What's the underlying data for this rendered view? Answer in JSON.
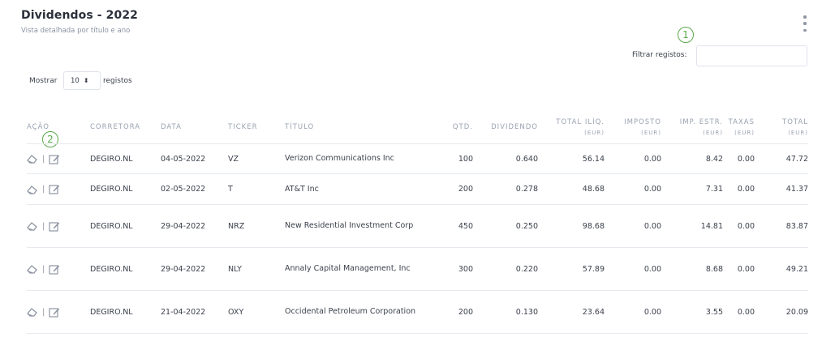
{
  "card": {
    "title": "Dividendos - 2022",
    "subtitle": "Vista detalhada por título e ano"
  },
  "markers": [
    "1",
    "2"
  ],
  "filter": {
    "label": "Filtrar registos:",
    "value": ""
  },
  "length": {
    "prefix": "Mostrar",
    "value": "10",
    "suffix": "registos"
  },
  "table": {
    "headers": {
      "acao": "AÇÃO",
      "corretora": "CORRETORA",
      "data": "DATA",
      "ticker": "TICKER",
      "titulo": "TÍTULO",
      "qtd": "QTD.",
      "dividendo": "DIVIDENDO",
      "total_iliq": "TOTAL ILÍQ.",
      "imposto": "IMPOSTO",
      "imp_estr": "IMP. ESTR.",
      "taxas": "TAXAS",
      "total": "TOTAL",
      "eur": "(EUR)"
    },
    "rows": [
      {
        "corretora": "DEGIRO.NL",
        "data": "04-05-2022",
        "ticker": "VZ",
        "titulo": "Verizon Communications Inc",
        "qtd": "100",
        "dividendo": "0.640",
        "total_iliq": "56.14",
        "imposto": "0.00",
        "imp_estr": "8.42",
        "taxas": "0.00",
        "total": "47.72"
      },
      {
        "corretora": "DEGIRO.NL",
        "data": "02-05-2022",
        "ticker": "T",
        "titulo": "AT&T Inc",
        "qtd": "200",
        "dividendo": "0.278",
        "total_iliq": "48.68",
        "imposto": "0.00",
        "imp_estr": "7.31",
        "taxas": "0.00",
        "total": "41.37"
      },
      {
        "corretora": "DEGIRO.NL",
        "data": "29-04-2022",
        "ticker": "NRZ",
        "titulo": "New Residential Investment Corp",
        "qtd": "450",
        "dividendo": "0.250",
        "total_iliq": "98.68",
        "imposto": "0.00",
        "imp_estr": "14.81",
        "taxas": "0.00",
        "total": "83.87"
      },
      {
        "corretora": "DEGIRO.NL",
        "data": "29-04-2022",
        "ticker": "NLY",
        "titulo": "Annaly Capital Management, Inc",
        "qtd": "300",
        "dividendo": "0.220",
        "total_iliq": "57.89",
        "imposto": "0.00",
        "imp_estr": "8.68",
        "taxas": "0.00",
        "total": "49.21"
      },
      {
        "corretora": "DEGIRO.NL",
        "data": "21-04-2022",
        "ticker": "OXY",
        "titulo": "Occidental Petroleum Corporation",
        "qtd": "200",
        "dividendo": "0.130",
        "total_iliq": "23.64",
        "imposto": "0.00",
        "imp_estr": "3.55",
        "taxas": "0.00",
        "total": "20.09"
      }
    ],
    "action_separator": "|",
    "icons": {
      "delete": "eraser-icon",
      "edit": "edit-icon"
    }
  },
  "colors": {
    "marker": "#5aa84a",
    "header_text": "#9aa2b1",
    "border": "#e6e9ee"
  }
}
